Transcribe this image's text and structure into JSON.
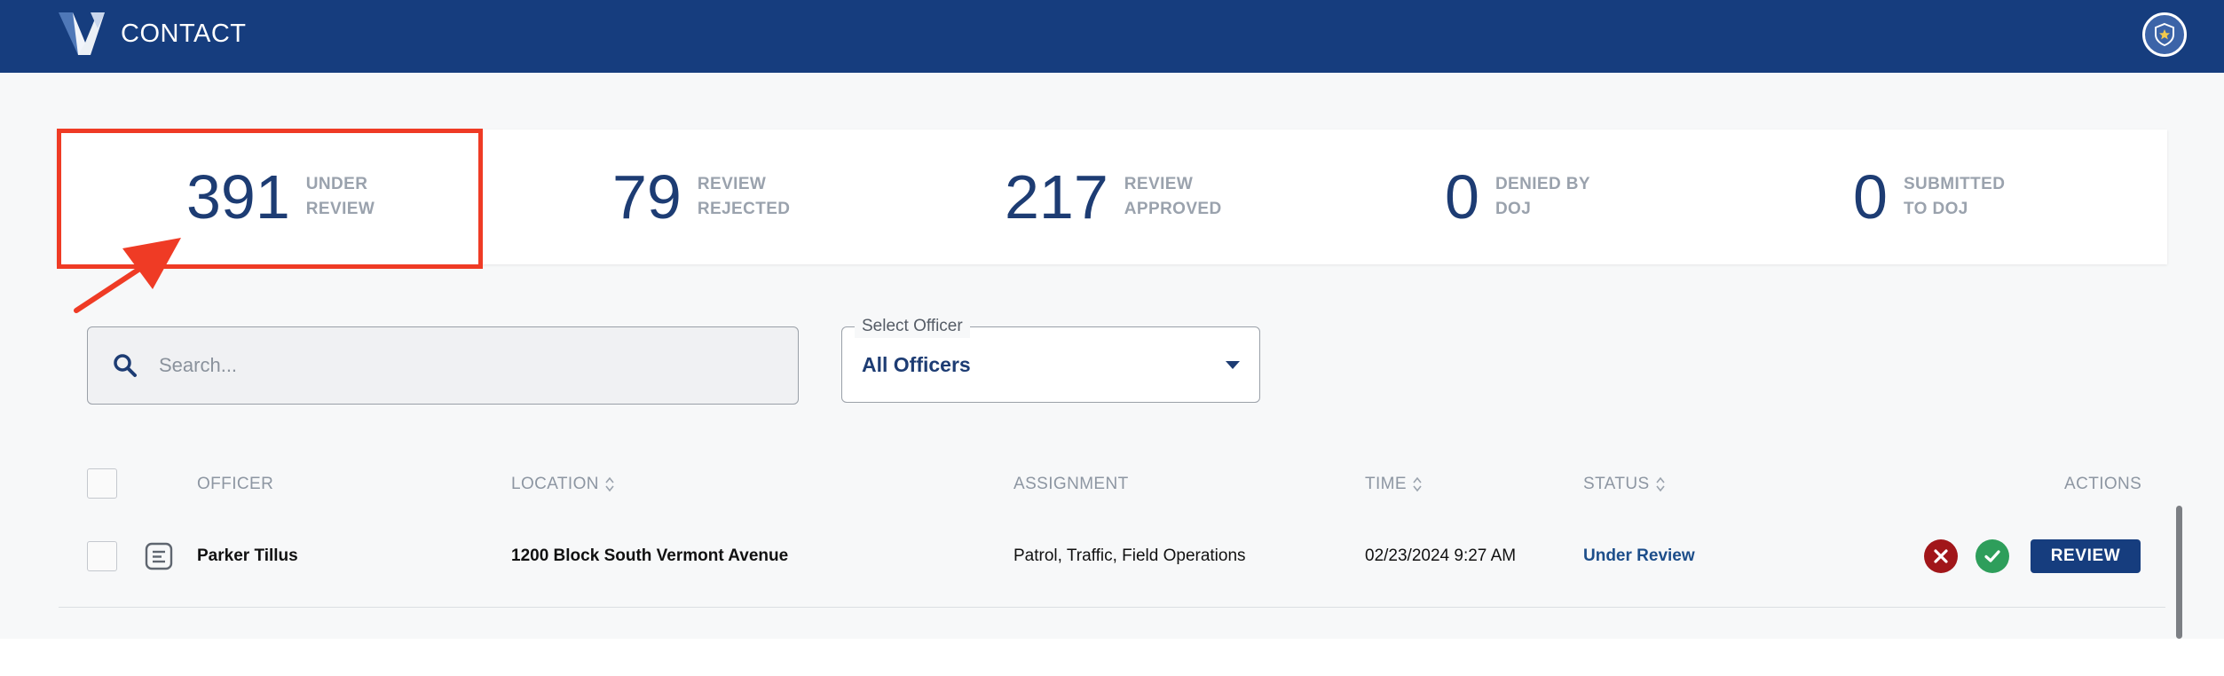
{
  "header": {
    "title": "CONTACT",
    "logo_icon": "v-logo-icon",
    "profile_icon": "shield-badge-icon",
    "background_color": "#163d7e"
  },
  "stats": [
    {
      "value": "391",
      "label_line1": "UNDER",
      "label_line2": "REVIEW",
      "highlighted": true
    },
    {
      "value": "79",
      "label_line1": "REVIEW",
      "label_line2": "REJECTED"
    },
    {
      "value": "217",
      "label_line1": "REVIEW",
      "label_line2": "APPROVED"
    },
    {
      "value": "0",
      "label_line1": "DENIED BY",
      "label_line2": "DOJ"
    },
    {
      "value": "0",
      "label_line1": "SUBMITTED",
      "label_line2": "TO DOJ"
    }
  ],
  "annotation": {
    "highlight_color": "#ef3b25"
  },
  "search": {
    "placeholder": "Search...",
    "value": ""
  },
  "officer_filter": {
    "label": "Select Officer",
    "selected": "All Officers"
  },
  "table": {
    "columns": {
      "officer": "OFFICER",
      "location": "LOCATION",
      "assignment": "ASSIGNMENT",
      "time": "TIME",
      "status": "STATUS",
      "actions": "ACTIONS"
    },
    "rows": [
      {
        "officer": "Parker Tillus",
        "location": "1200 Block South Vermont Avenue",
        "assignment": "Patrol, Traffic, Field Operations",
        "time": "02/23/2024 9:27 AM",
        "status": "Under Review",
        "review_label": "REVIEW"
      }
    ]
  },
  "colors": {
    "primary": "#163d7e",
    "reject": "#a1161a",
    "approve": "#2e9e5b"
  }
}
